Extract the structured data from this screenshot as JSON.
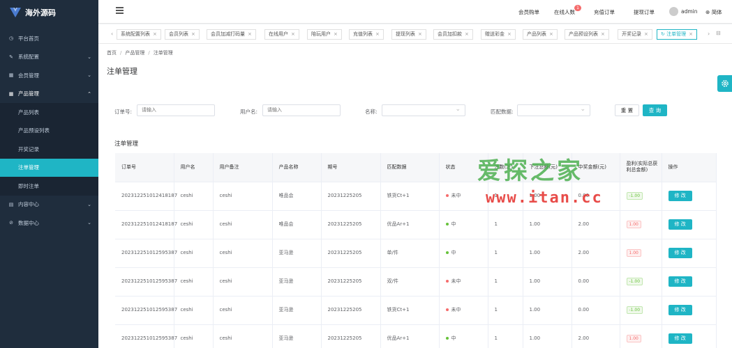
{
  "app": {
    "title": "海外源码"
  },
  "sidebar": {
    "items": [
      {
        "label": "平台首页",
        "icon": "clock-icon"
      },
      {
        "label": "系统配置",
        "icon": "edit-icon"
      },
      {
        "label": "会员管理",
        "icon": "grid-icon"
      },
      {
        "label": "产品管理",
        "icon": "grid-icon"
      }
    ],
    "sub_items": [
      "产品列表",
      "产品预设列表",
      "开奖记录",
      "注单管理",
      "即时注单"
    ],
    "bottom_items": [
      {
        "label": "内容中心",
        "icon": "doc-icon"
      },
      {
        "label": "数据中心",
        "icon": "check-circle-icon"
      }
    ]
  },
  "header": {
    "nav": [
      "会员购单",
      "在线人数",
      "充值订单",
      "提现订单"
    ],
    "online_badge": "1",
    "user": "admin",
    "lang": "简体"
  },
  "tabs": [
    "系统配置列表",
    "会员列表",
    "会员加减打码量",
    "在线用户",
    "陪玩用户",
    "充值列表",
    "提现列表",
    "会员加扣款",
    "赠送彩金",
    "产品列表",
    "产品预设列表",
    "开奖记录",
    "注单管理"
  ],
  "breadcrumb": [
    "首页",
    "产品管理",
    "注单管理"
  ],
  "page_title": "注单管理",
  "filters": {
    "order_label": "订单号:",
    "order_placeholder": "请输入",
    "user_label": "用户名:",
    "user_placeholder": "请输入",
    "name_label": "名称:",
    "match_label": "匹配数据:",
    "reset": "重 置",
    "search": "查 询"
  },
  "section_title": "注单管理",
  "table": {
    "headers": [
      "订单号",
      "用户名",
      "用户备注",
      "产品名称",
      "期号",
      "匹配数据",
      "状态",
      "注数(注)",
      "下注总额(元)",
      "中奖金额(元)",
      "盈利(实际总获利总金额)",
      "操作"
    ],
    "rows": [
      [
        "202312251012418187",
        "ceshi",
        "ceshi",
        "唯品会",
        "20231225205",
        "铁货Ct+1",
        "未中",
        "1",
        "1.00",
        "0.00",
        "-1.00"
      ],
      [
        "202312251012418187",
        "ceshi",
        "ceshi",
        "唯品会",
        "20231225205",
        "优品Ar+1",
        "中",
        "1",
        "1.00",
        "2.00",
        "1.00"
      ],
      [
        "202312251012595387",
        "ceshi",
        "ceshi",
        "亚马逊",
        "20231225205",
        "单/件",
        "中",
        "1",
        "1.00",
        "2.00",
        "1.00"
      ],
      [
        "202312251012595387",
        "ceshi",
        "ceshi",
        "亚马逊",
        "20231225205",
        "双/件",
        "未中",
        "1",
        "1.00",
        "0.00",
        "-1.00"
      ],
      [
        "202312251012595387",
        "ceshi",
        "ceshi",
        "亚马逊",
        "20231225205",
        "铁货Ct+1",
        "未中",
        "1",
        "1.00",
        "0.00",
        "-1.00"
      ],
      [
        "202312251012595387",
        "ceshi",
        "ceshi",
        "亚马逊",
        "20231225205",
        "优品Ar+1",
        "中",
        "1",
        "1.00",
        "2.00",
        "1.00"
      ]
    ],
    "edit_label": "修 改"
  },
  "watermark": {
    "cn": "爱探之家",
    "url": "www.itan.cc"
  },
  "colors": {
    "accent": "#1fb5c5",
    "sidebar": "#1f2d3d",
    "win": "#67c23a",
    "lose": "#f56c6c"
  }
}
